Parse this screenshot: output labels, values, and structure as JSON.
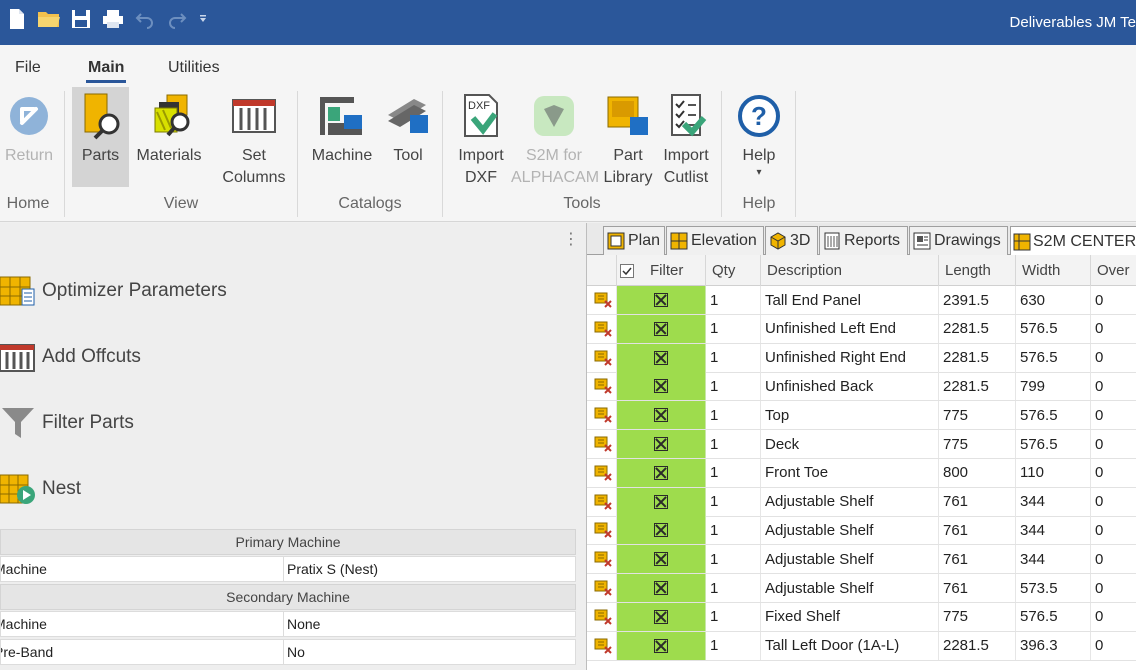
{
  "title_bar": {
    "app_title": "Deliverables JM Te",
    "qat_icons": [
      "new-file-icon",
      "open-folder-icon",
      "save-icon",
      "print-icon",
      "undo-icon",
      "redo-icon",
      "customize-dropdown-icon"
    ]
  },
  "ribbon_tabs": [
    {
      "label": "File"
    },
    {
      "label": "Main"
    },
    {
      "label": "Utilities"
    }
  ],
  "ribbon": {
    "groups": {
      "home": "Home",
      "view": "View",
      "catalogs": "Catalogs",
      "tools": "Tools",
      "help": "Help"
    },
    "buttons": {
      "return": {
        "line1": "Return",
        "line2": ""
      },
      "parts": {
        "line1": "Parts",
        "line2": ""
      },
      "materials": {
        "line1": "Materials",
        "line2": ""
      },
      "set_columns": {
        "line1": "Set",
        "line2": "Columns"
      },
      "machine": {
        "line1": "Machine",
        "line2": ""
      },
      "tool": {
        "line1": "Tool",
        "line2": ""
      },
      "import_dxf": {
        "line1": "Import",
        "line2": "DXF",
        "icon_text": "DXF"
      },
      "s2m_alphacam": {
        "line1": "S2M for",
        "line2": "ALPHACAM"
      },
      "part_library": {
        "line1": "Part",
        "line2": "Library"
      },
      "import_cutlist": {
        "line1": "Import",
        "line2": "Cutlist"
      },
      "help": {
        "line1": "Help",
        "line2": "▾"
      }
    }
  },
  "left_panel": {
    "tasks": [
      {
        "label": "Optimizer Parameters"
      },
      {
        "label": "Add Offcuts"
      },
      {
        "label": "Filter Parts"
      },
      {
        "label": "Nest"
      }
    ],
    "kebab": "⋮",
    "primary_header": "Primary Machine",
    "secondary_header": "Secondary Machine",
    "primary_rows": [
      {
        "key": "Machine",
        "value": "Pratix S (Nest)"
      }
    ],
    "secondary_rows": [
      {
        "key": "Machine",
        "value": "None"
      },
      {
        "key": "Pre-Band",
        "value": "No"
      }
    ]
  },
  "view_tabs": [
    {
      "label": "Plan"
    },
    {
      "label": "Elevation"
    },
    {
      "label": "3D"
    },
    {
      "label": "Reports"
    },
    {
      "label": "Drawings"
    },
    {
      "label": "S2M CENTER"
    }
  ],
  "grid": {
    "headers": {
      "filter": "Filter",
      "qty": "Qty",
      "description": "Description",
      "length": "Length",
      "width": "Width",
      "over": "Over"
    },
    "rows": [
      {
        "qty": "1",
        "description": "Tall End Panel",
        "length": "2391.5",
        "width": "630",
        "over": "0"
      },
      {
        "qty": "1",
        "description": "Unfinished Left End",
        "length": "2281.5",
        "width": "576.5",
        "over": "0"
      },
      {
        "qty": "1",
        "description": "Unfinished Right End",
        "length": "2281.5",
        "width": "576.5",
        "over": "0"
      },
      {
        "qty": "1",
        "description": "Unfinished Back",
        "length": "2281.5",
        "width": "799",
        "over": "0"
      },
      {
        "qty": "1",
        "description": "Top",
        "length": "775",
        "width": "576.5",
        "over": "0"
      },
      {
        "qty": "1",
        "description": "Deck",
        "length": "775",
        "width": "576.5",
        "over": "0"
      },
      {
        "qty": "1",
        "description": "Front Toe",
        "length": "800",
        "width": "110",
        "over": "0"
      },
      {
        "qty": "1",
        "description": "Adjustable Shelf",
        "length": "761",
        "width": "344",
        "over": "0"
      },
      {
        "qty": "1",
        "description": "Adjustable Shelf",
        "length": "761",
        "width": "344",
        "over": "0"
      },
      {
        "qty": "1",
        "description": "Adjustable Shelf",
        "length": "761",
        "width": "344",
        "over": "0"
      },
      {
        "qty": "1",
        "description": "Adjustable Shelf",
        "length": "761",
        "width": "573.5",
        "over": "0"
      },
      {
        "qty": "1",
        "description": "Fixed Shelf",
        "length": "775",
        "width": "576.5",
        "over": "0"
      },
      {
        "qty": "1",
        "description": "Tall Left Door (1A-L)",
        "length": "2281.5",
        "width": "396.3",
        "over": "0"
      }
    ]
  },
  "colors": {
    "title_bar": "#2b579a",
    "filter_cell": "#9edc4d",
    "accent_blue": "#1f5fa8"
  }
}
